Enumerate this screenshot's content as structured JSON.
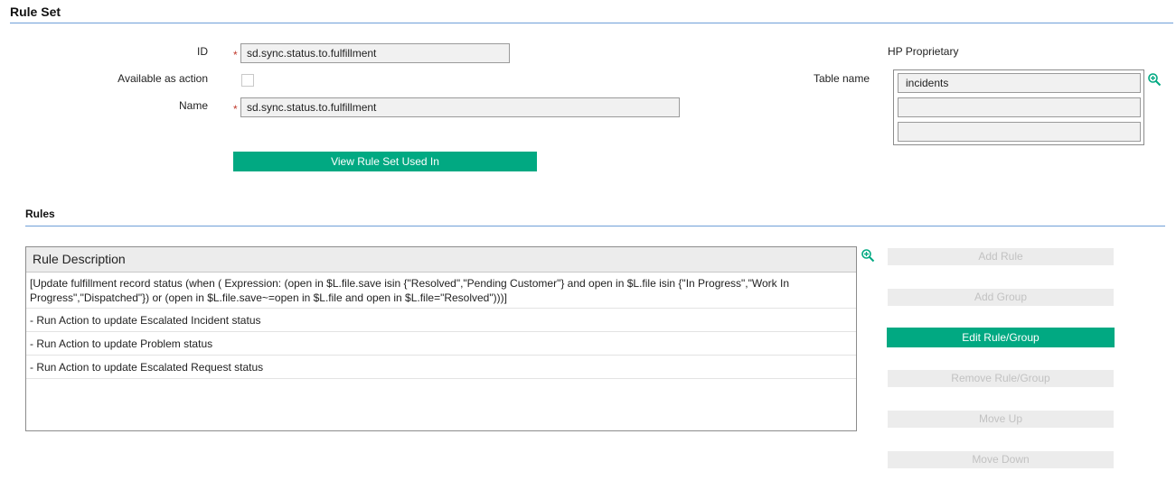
{
  "header": {
    "title": "Rule Set"
  },
  "form": {
    "id_label": "ID",
    "id_value": "sd.sync.status.to.fulfillment",
    "available_label": "Available as action",
    "name_label": "Name",
    "name_value": "sd.sync.status.to.fulfillment",
    "required_mark": "*",
    "view_button": "View Rule Set Used In"
  },
  "right_panel": {
    "proprietary": "HP Proprietary",
    "table_label": "Table name",
    "tables": [
      "incidents",
      "",
      ""
    ]
  },
  "rules": {
    "title": "Rules",
    "column_header": "Rule Description",
    "rows": [
      "[Update fulfillment record status (when ( Expression: (open in $L.file.save isin {\"Resolved\",\"Pending Customer\"} and open in $L.file isin {\"In Progress\",\"Work In Progress\",\"Dispatched\"}) or (open in $L.file.save~=open in $L.file and open in $L.file=\"Resolved\")))]",
      "- Run Action to update Escalated Incident status",
      "- Run Action to update Problem status",
      "- Run Action to update Escalated Request status"
    ]
  },
  "actions": {
    "add_rule": "Add Rule",
    "add_group": "Add Group",
    "edit": "Edit Rule/Group",
    "remove": "Remove Rule/Group",
    "move_up": "Move Up",
    "move_down": "Move Down"
  },
  "colors": {
    "accent": "#01a982",
    "divider": "#6f9fd8",
    "required": "#c0392b"
  }
}
